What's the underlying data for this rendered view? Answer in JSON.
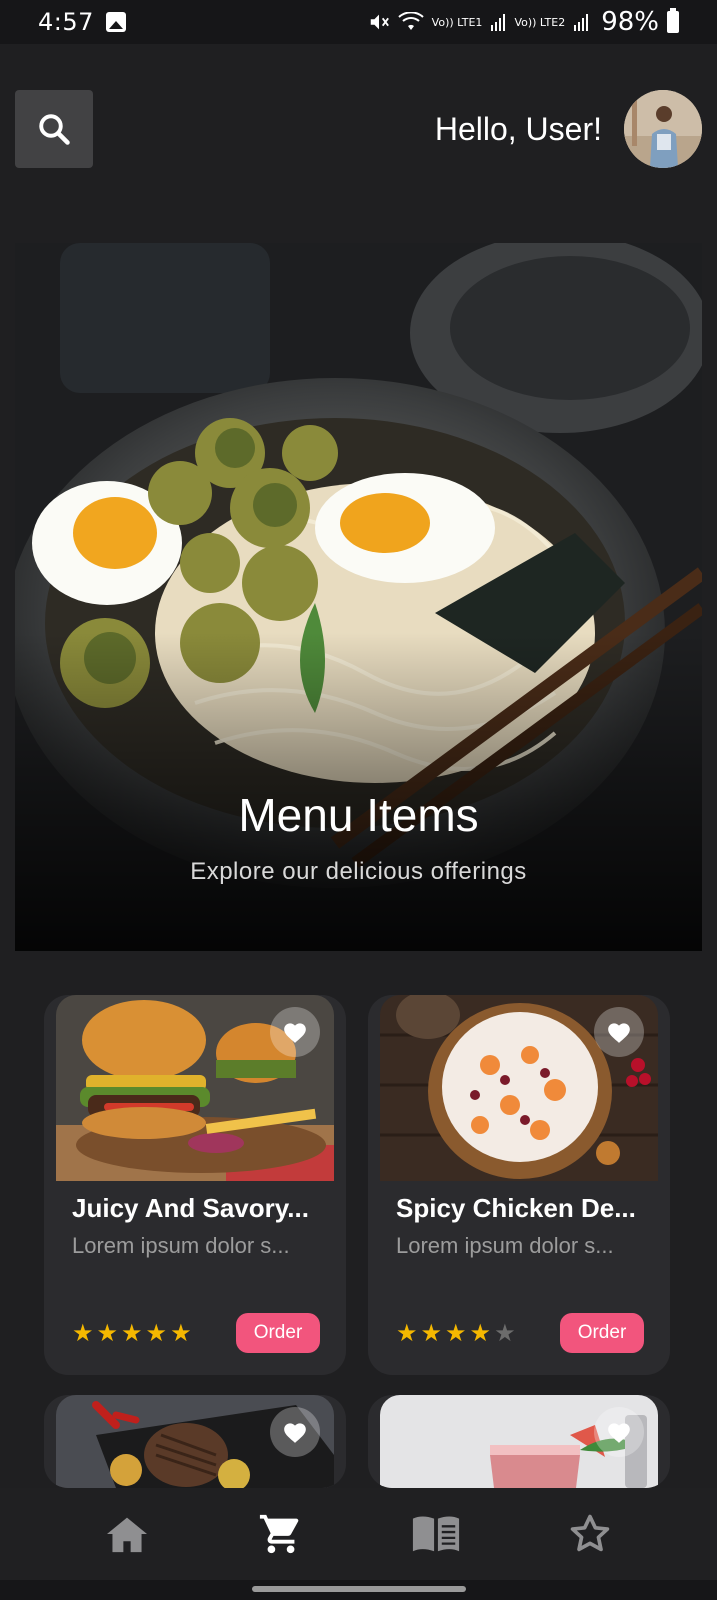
{
  "status_bar": {
    "time": "4:57",
    "sim1": "Vo)) LTE1",
    "sim2": "Vo)) LTE2",
    "battery_pct": "98%"
  },
  "header": {
    "greeting": "Hello, User!",
    "search_icon": "search-icon",
    "avatar_icon": "user-avatar"
  },
  "hero": {
    "title": "Menu Items",
    "subtitle": "Explore our delicious offerings"
  },
  "menu_items": [
    {
      "name": "Juicy And Savory...",
      "desc": "Lorem ipsum dolor s...",
      "rating": 5,
      "order_label": "Order",
      "image": "burger"
    },
    {
      "name": "Spicy Chicken De...",
      "desc": "Lorem ipsum dolor s...",
      "rating": 4,
      "order_label": "Order",
      "image": "pizza"
    },
    {
      "name": "",
      "desc": "",
      "rating": 0,
      "order_label": "",
      "image": "steak"
    },
    {
      "name": "",
      "desc": "",
      "rating": 0,
      "order_label": "",
      "image": "drink"
    }
  ],
  "bottom_nav": [
    {
      "icon": "home-icon",
      "active": false
    },
    {
      "icon": "cart-icon",
      "active": true
    },
    {
      "icon": "menu-book-icon",
      "active": false
    },
    {
      "icon": "star-outline-icon",
      "active": false
    }
  ],
  "colors": {
    "background": "#1f1f21",
    "card": "#2b2b2e",
    "order_button": "#f2557d",
    "star_filled": "#f5b800",
    "star_empty": "#6c6c6c"
  }
}
